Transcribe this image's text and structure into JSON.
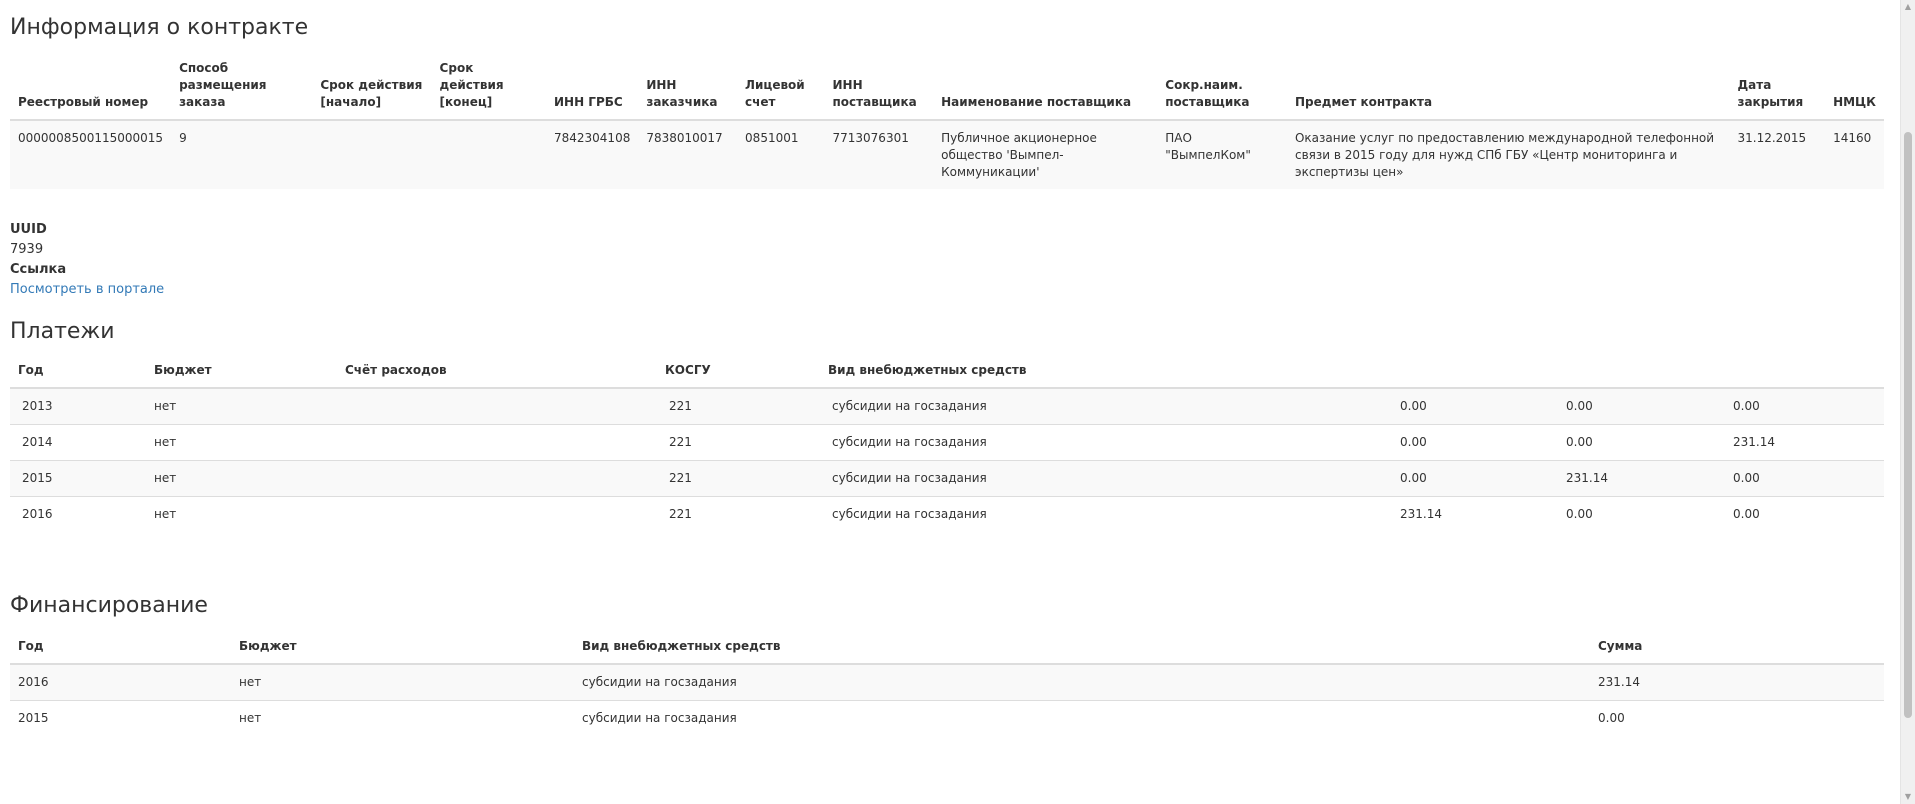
{
  "contract": {
    "title": "Информация о контракте",
    "headers": [
      "Реестровый номер",
      "Способ размещения заказа",
      "Срок действия [начало]",
      "Срок действия [конец]",
      "ИНН ГРБС",
      "ИНН заказчика",
      "Лицевой счет",
      "ИНН поставщика",
      "Наименование поставщика",
      "Сокр.наим. поставщика",
      "Предмет контракта",
      "Дата закрытия",
      "НМЦК"
    ],
    "row": {
      "reg_number": "0000008500115000015",
      "method": "9",
      "start": "",
      "end": "",
      "inn_grbs": "7842304108",
      "inn_customer": "7838010017",
      "account": "0851001",
      "inn_supplier": "7713076301",
      "supplier_name": "Публичное акционерное общество 'Вымпел-Коммуникации'",
      "supplier_short": "ПАО \"ВымпелКом\"",
      "subject": "Оказание услуг по предоставлению международной телефонной связи в 2015 году для нужд СПб ГБУ «Центр мониторинга и экспертизы цен»",
      "close_date": "31.12.2015",
      "nmck": "14160"
    }
  },
  "meta": {
    "uuid_label": "UUID",
    "uuid_value": "7939",
    "link_label": "Ссылка",
    "link_text": "Посмотреть в портале"
  },
  "payments": {
    "title": "Платежи",
    "headers": [
      "Год",
      "Бюджет",
      "Счёт расходов",
      "КОСГУ",
      "Вид внебюджетных средств",
      "",
      "",
      ""
    ],
    "rows": [
      {
        "year": "2013",
        "budget": "нет",
        "account": "",
        "kosgu": "221",
        "type": "субсидии на госзадания",
        "a": "0.00",
        "b": "0.00",
        "c": "0.00"
      },
      {
        "year": "2014",
        "budget": "нет",
        "account": "",
        "kosgu": "221",
        "type": "субсидии на госзадания",
        "a": "0.00",
        "b": "0.00",
        "c": "231.14"
      },
      {
        "year": "2015",
        "budget": "нет",
        "account": "",
        "kosgu": "221",
        "type": "субсидии на госзадания",
        "a": "0.00",
        "b": "231.14",
        "c": "0.00"
      },
      {
        "year": "2016",
        "budget": "нет",
        "account": "",
        "kosgu": "221",
        "type": "субсидии на госзадания",
        "a": "231.14",
        "b": "0.00",
        "c": "0.00"
      }
    ]
  },
  "financing": {
    "title": "Финансирование",
    "headers": [
      "Год",
      "Бюджет",
      "Вид внебюджетных средств",
      "Сумма"
    ],
    "rows": [
      {
        "year": "2016",
        "budget": "нет",
        "type": "субсидии на госзадания",
        "sum": "231.14"
      },
      {
        "year": "2015",
        "budget": "нет",
        "type": "субсидии на госзадания",
        "sum": "0.00"
      }
    ]
  }
}
